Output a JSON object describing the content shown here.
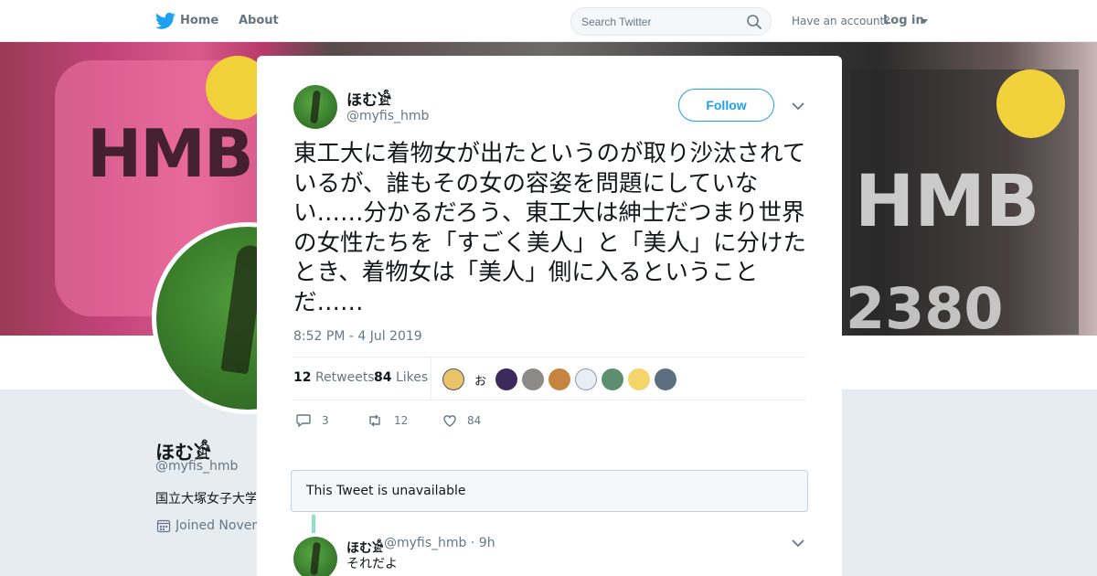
{
  "nav": {
    "home_label": "Home",
    "about_label": "About",
    "search_placeholder": "Search Twitter",
    "account_prompt": "Have an account?",
    "login_label": "Log in"
  },
  "profile": {
    "name": "ほむ𓀀",
    "handle": "@myfis_hmb",
    "bio": "国立大塚女子大学",
    "joined": "Joined Novem"
  },
  "tweet": {
    "author_name": "ほむ𓀀",
    "author_handle": "@myfis_hmb",
    "follow_label": "Follow",
    "text": "東工大に着物女が出たというのが取り沙汰されているが、誰もその女の容姿を問題にしていない……分かるだろう、東工大は紳士だつまり世界の女性たちを「すごく美人」と「美人」に分けたとき、着物女は「美人」側に入るということだ……",
    "timestamp": "8:52 PM - 4 Jul 2019",
    "retweets_count": "12",
    "retweets_label": "Retweets",
    "likes_count": "84",
    "likes_label": "Likes",
    "liker_text": "お",
    "reply_count": "3",
    "retweet_count": "12",
    "like_count": "84"
  },
  "unavailable_text": "This Tweet is unavailable",
  "reply": {
    "author_name": "ほむ𓀀",
    "author_handle": "@myfis_hmb · 9h",
    "text": "それだよ"
  },
  "colors": {
    "accent": "#1da1f2",
    "thread_line": "#8fe0c4",
    "muted": "#657786"
  }
}
